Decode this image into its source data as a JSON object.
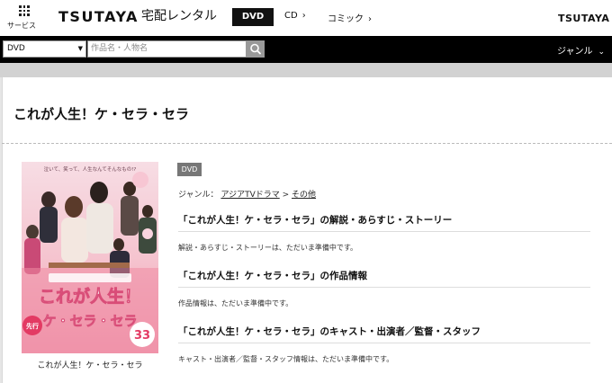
{
  "header": {
    "service_label": "サービス",
    "logo": "TSUTAYA",
    "subtitle": "宅配レンタル",
    "tabs": [
      {
        "label": "DVD",
        "active": true
      },
      {
        "label": "CD",
        "active": false
      },
      {
        "label": "コミック",
        "active": false
      }
    ],
    "right_logo": "TSUTAYA T"
  },
  "search": {
    "category_value": "DVD",
    "placeholder": "作品名・人物名",
    "genre_label": "ジャンル"
  },
  "product": {
    "title": "これが人生！ケ・セラ・セラ",
    "badge": "DVD",
    "genre_prefix": "ジャンル：",
    "genre_link_1": "アジアTVドラマ",
    "genre_separator": ">",
    "genre_link_2": "その他",
    "cover_caption": "これが人生！ケ・セラ・セラ",
    "cover_art": {
      "tagline": "泣いて、笑って、人生なんてそんなもの!?",
      "title_line_1": "これが人生！",
      "title_line_2": "ケ・セラ・セラ",
      "badge": "先行",
      "vol_number": "33"
    },
    "sections": [
      {
        "heading": "「これが人生！ケ・セラ・セラ」の解説・あらすじ・ストーリー",
        "text": "解説・あらすじ・ストーリーは、ただいま準備中です。"
      },
      {
        "heading": "「これが人生！ケ・セラ・セラ」の作品情報",
        "text": "作品情報は、ただいま準備中です。"
      },
      {
        "heading": "「これが人生！ケ・セラ・セラ」のキャスト・出演者／監督・スタッフ",
        "text": "キャスト・出演者／監督・スタッフ情報は、ただいま準備中です。"
      }
    ]
  },
  "colors": {
    "header_bg": "#ffffff",
    "search_bar_bg": "#000000",
    "page_bg": "#e6e6e6",
    "badge_bg": "#777777",
    "cover_pink": "#f2b8c6"
  }
}
